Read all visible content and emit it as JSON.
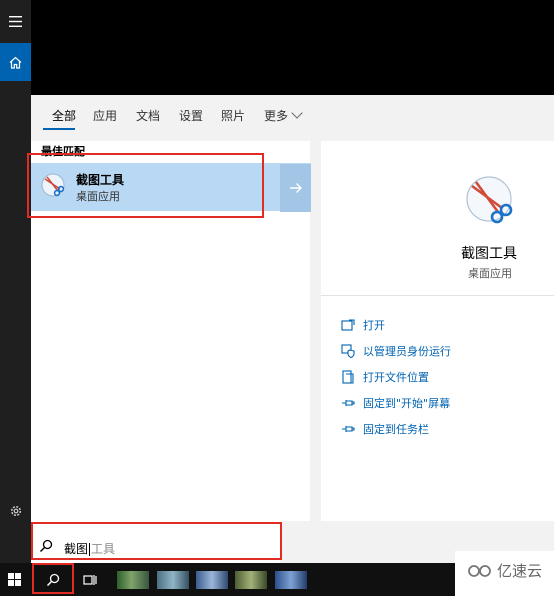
{
  "tabs": [
    {
      "label": "全部",
      "active": true
    },
    {
      "label": "应用"
    },
    {
      "label": "文档"
    },
    {
      "label": "设置"
    },
    {
      "label": "照片"
    },
    {
      "label": "更多"
    }
  ],
  "results": {
    "section_label": "最佳匹配",
    "best_match": {
      "title": "截图工具",
      "subtitle": "桌面应用"
    }
  },
  "detail": {
    "title": "截图工具",
    "subtitle": "桌面应用",
    "actions": [
      {
        "label": "打开",
        "icon": "open-window-icon"
      },
      {
        "label": "以管理员身份运行",
        "icon": "admin-shield-icon"
      },
      {
        "label": "打开文件位置",
        "icon": "file-location-icon"
      },
      {
        "label": "固定到\"开始\"屏幕",
        "icon": "pin-icon"
      },
      {
        "label": "固定到任务栏",
        "icon": "pin-icon"
      }
    ]
  },
  "search": {
    "typed": "截图",
    "suggestion": "工具"
  },
  "watermark": "亿速云",
  "colors": {
    "accent": "#0063b1",
    "selection": "#b9d8f3",
    "highlight": "#e12b23"
  }
}
